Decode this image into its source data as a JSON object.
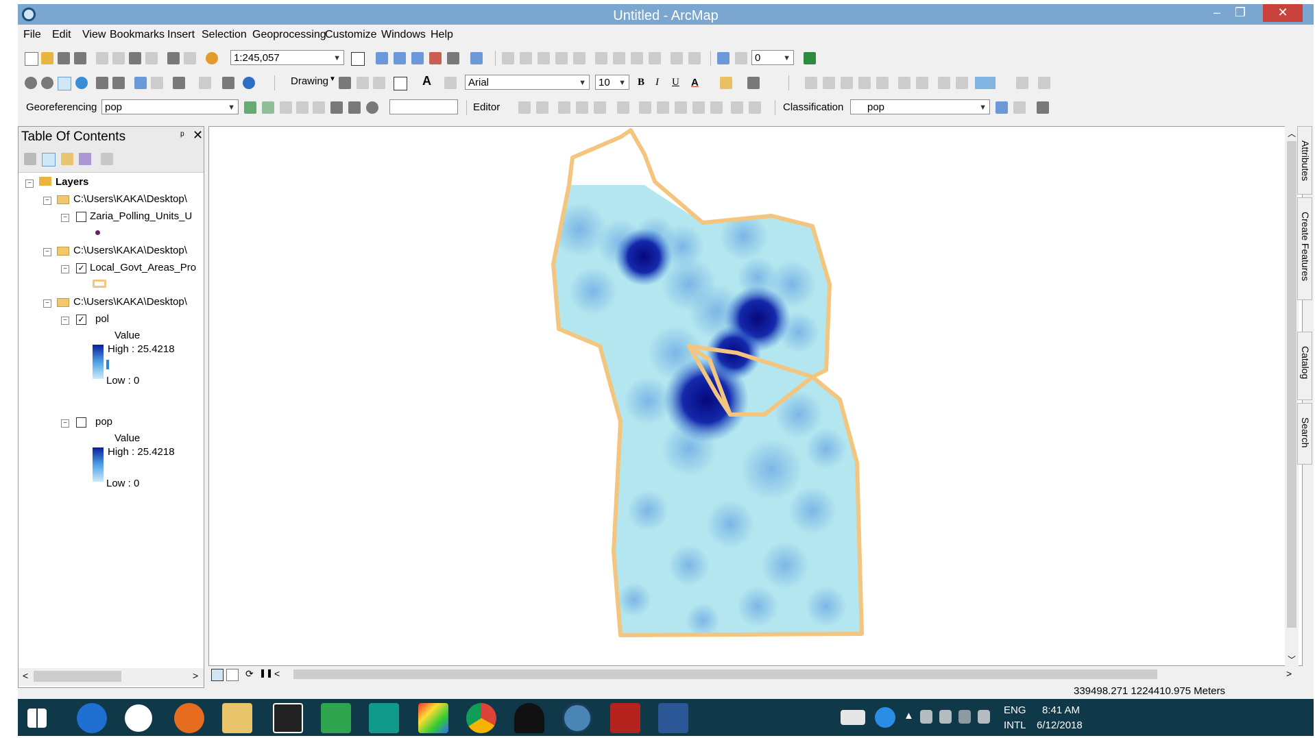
{
  "window": {
    "title": "Untitled - ArcMap",
    "min": "–",
    "max": "❐",
    "close": "✕"
  },
  "menu": [
    "File",
    "Edit",
    "View",
    "Bookmarks",
    "Insert",
    "Selection",
    "Geoprocessing",
    "Customize",
    "Windows",
    "Help"
  ],
  "toolbar": {
    "scale": "1:245,057",
    "drawing_label": "Drawing",
    "font": "Arial",
    "font_size": "10",
    "bold": "B",
    "italic": "I",
    "underline": "U",
    "font_color": "A",
    "text_tool": "A",
    "small_combo": "0",
    "georef_label": "Georeferencing",
    "georef_layer": "pop",
    "editor_label": "Editor",
    "classification_label": "Classification",
    "classification_layer": "pop"
  },
  "toc": {
    "title": "Table Of Contents",
    "pin": "ᵖ",
    "close": "✕",
    "root": "Layers",
    "groups": [
      {
        "path": "C:\\Users\\KAKA\\Desktop\\",
        "layer": "Zaria_Polling_Units_U",
        "checked": false
      },
      {
        "path": "C:\\Users\\KAKA\\Desktop\\",
        "layer": "Local_Govt_Areas_Pro",
        "checked": true
      },
      {
        "path": "C:\\Users\\KAKA\\Desktop\\",
        "layers": [
          {
            "name": "pol",
            "checked": true,
            "value_label": "Value",
            "high": "High : 25.4218",
            "low": "Low : 0"
          },
          {
            "name": "pop",
            "checked": false,
            "value_label": "Value",
            "high": "High : 25.4218",
            "low": "Low : 0"
          }
        ]
      }
    ]
  },
  "side_tabs": [
    "Attributes",
    "Create Features",
    "Catalog",
    "Search"
  ],
  "status": {
    "coords": "339498.271  1224410.975 Meters"
  },
  "taskbar": {
    "lang": "ENG",
    "locale": "INTL",
    "time": "8:41 AM",
    "date": "6/12/2018"
  },
  "colors": {
    "boundary": "#f3c57e",
    "fill": "#b3e6ee",
    "hotspot": "#05087c",
    "titlebar": "#7aa6d0",
    "taskbar": "#0f3848"
  }
}
